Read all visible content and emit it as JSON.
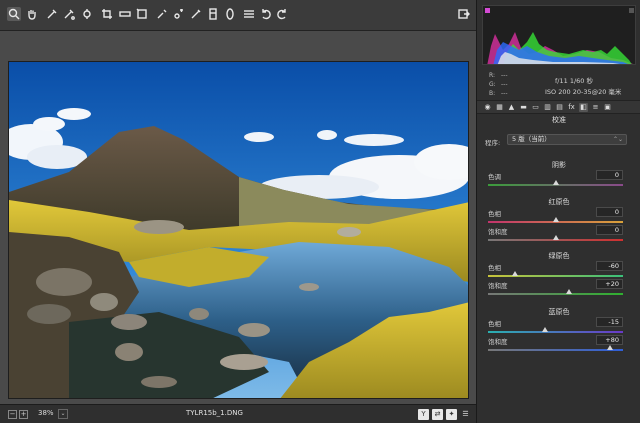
{
  "toolbar": {
    "tools": [
      {
        "icon": "zoom-icon"
      },
      {
        "icon": "hand-icon"
      },
      {
        "icon": "white-balance-icon"
      },
      {
        "icon": "color-sampler-icon"
      },
      {
        "icon": "targeted-adjust-icon"
      },
      {
        "icon": "crop-icon"
      },
      {
        "icon": "straighten-icon"
      },
      {
        "icon": "transform-icon"
      },
      {
        "icon": "spot-removal-icon"
      },
      {
        "icon": "red-eye-icon"
      },
      {
        "icon": "adjustment-brush-icon"
      },
      {
        "icon": "graduated-filter-icon"
      },
      {
        "icon": "radial-filter-icon"
      },
      {
        "icon": "preferences-icon"
      },
      {
        "icon": "rotate-left-icon"
      },
      {
        "icon": "rotate-right-icon"
      }
    ],
    "fullscreen_icon": "fullscreen-icon"
  },
  "status": {
    "zoom": "38%",
    "filename": "TYLR15b_1.DNG"
  },
  "info": {
    "r_label": "R:",
    "g_label": "G:",
    "b_label": "B:",
    "r_value": "---",
    "g_value": "---",
    "b_value": "---",
    "aperture_shutter": "f/11   1/60 秒",
    "iso_lens": "ISO 200   20-35@20 毫米"
  },
  "panel": {
    "title": "校准",
    "program_label": "程序:",
    "program_value": "5 版（当前）",
    "groups": [
      {
        "title": "阴影",
        "rows": [
          {
            "label": "色调",
            "value": "0",
            "pos": 0.5
          }
        ]
      },
      {
        "title": "红原色",
        "rows": [
          {
            "label": "色相",
            "value": "0",
            "pos": 0.5
          },
          {
            "label": "饱和度",
            "value": "0",
            "pos": 0.5
          }
        ]
      },
      {
        "title": "绿原色",
        "rows": [
          {
            "label": "色相",
            "value": "-60",
            "pos": 0.2
          },
          {
            "label": "饱和度",
            "value": "+20",
            "pos": 0.6
          }
        ]
      },
      {
        "title": "蓝原色",
        "rows": [
          {
            "label": "色相",
            "value": "-15",
            "pos": 0.425
          },
          {
            "label": "饱和度",
            "value": "+80",
            "pos": 0.9
          }
        ]
      }
    ]
  },
  "colors": {
    "accent": "#3b3b3b",
    "track_tint": "#4a8f3a",
    "track_hue_red": "#c33a3a",
    "track_hue_green": "#3da53d",
    "track_hue_blue": "#3b62c8"
  }
}
